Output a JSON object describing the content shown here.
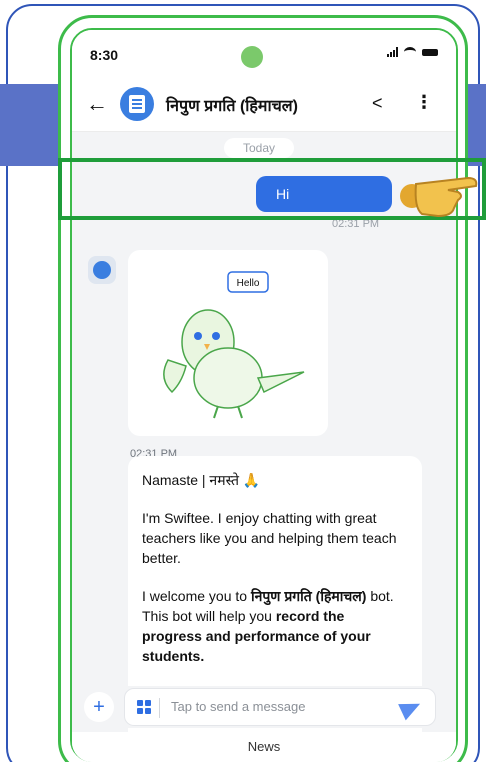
{
  "status_bar": {
    "time": "8:30"
  },
  "header": {
    "title": "निपुण प्रगति (हिमाचल)",
    "icons": [
      "back-arrow-icon",
      "share-icon",
      "more-vertical-icon"
    ]
  },
  "chat": {
    "date_label": "Today",
    "sent_message": {
      "text": "Hi",
      "time": "02:31 PM"
    },
    "image_message": {
      "sticker_text": "Hello",
      "time": "02:31 PM"
    },
    "bot_message": {
      "greeting": "Namaste | नमस्ते 🙏",
      "intro": "I'm Swiftee. I enjoy chatting with great teachers like you and helping them teach better.",
      "welcome_prefix": "I welcome you to",
      "bot_name": "निपुण प्रगति (हिमाचल)",
      "welcome_middle": "bot. This bot will help you",
      "welcome_bold": "record the progress and performance of your students."
    }
  },
  "composer": {
    "placeholder": "Tap to send a message"
  },
  "bottom_tab": {
    "label": "News"
  },
  "colors": {
    "highlight": "#1f9d3a",
    "phone_outline": "#3dbb4a",
    "accent": "#2f6ee2",
    "frame": "#2f55b8"
  }
}
